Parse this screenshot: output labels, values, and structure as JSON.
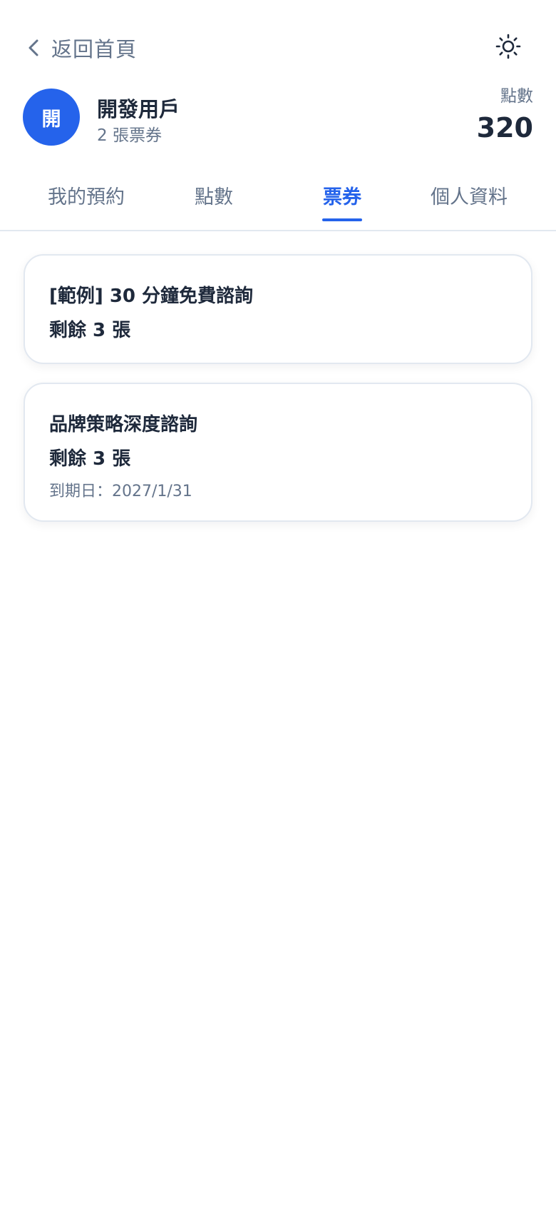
{
  "header": {
    "back_label": "返回首頁",
    "back_icon": "chevron-left-icon",
    "theme_icon": "sun-icon"
  },
  "profile": {
    "avatar_initial": "開",
    "name": "開發用戶",
    "ticket_count": "2 張票券",
    "points_label": "點數",
    "points_value": "320"
  },
  "tabs": [
    {
      "label": "我的預約",
      "active": false
    },
    {
      "label": "點數",
      "active": false
    },
    {
      "label": "票券",
      "active": true
    },
    {
      "label": "個人資料",
      "active": false
    }
  ],
  "tickets": [
    {
      "title": "[範例] 30 分鐘免費諮詢",
      "remaining": "剩餘 3 張"
    },
    {
      "title": "品牌策略深度諮詢",
      "remaining": "剩餘 3 張",
      "expiry": "到期日：2027/1/31"
    }
  ],
  "colors": {
    "accent": "#2563eb",
    "text_primary": "#1e293b",
    "text_secondary": "#64748b",
    "border": "#e2e8f0"
  }
}
